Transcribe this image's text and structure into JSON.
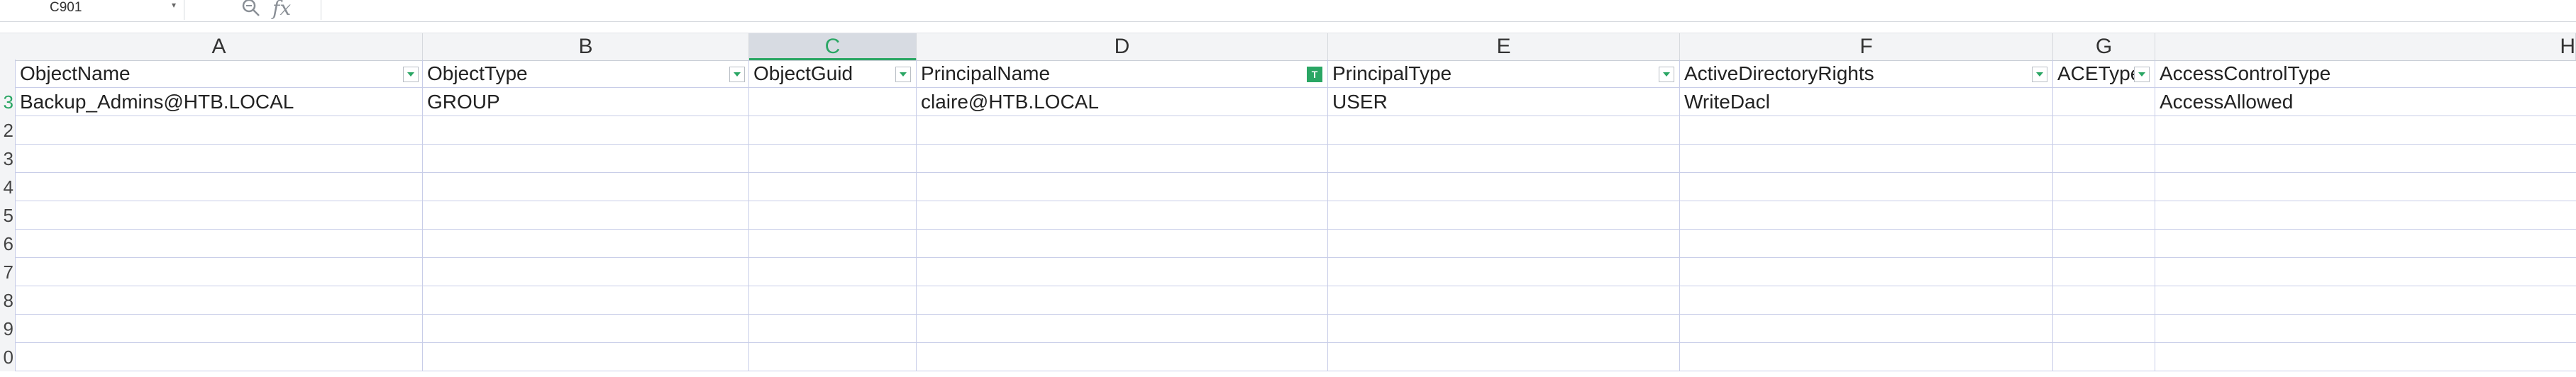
{
  "formula_bar": {
    "cell_ref": "C901",
    "fx_label": "fx",
    "formula": ""
  },
  "columns": [
    "A",
    "B",
    "C",
    "D",
    "E",
    "F",
    "G",
    "H"
  ],
  "selected_column": "C",
  "header_row": {
    "row_label": "",
    "cells": [
      "ObjectName",
      "ObjectType",
      "ObjectGuid",
      "PrincipalName",
      "PrincipalType",
      "ActiveDirectoryRights",
      "ACEType",
      "AccessControlType"
    ]
  },
  "active_filter_label": "T",
  "data_rows": [
    {
      "row_label": "3",
      "cells": [
        "Backup_Admins@HTB.LOCAL",
        "GROUP",
        "",
        "claire@HTB.LOCAL",
        "USER",
        "WriteDacl",
        "",
        "AccessAllowed"
      ]
    }
  ],
  "empty_row_labels": [
    "2",
    "3",
    "4",
    "5",
    "6",
    "7",
    "8",
    "9",
    "0"
  ],
  "colors": {
    "accent": "#2aa664",
    "grid_line": "#c8cde8",
    "header_bg": "#f3f4f6"
  }
}
